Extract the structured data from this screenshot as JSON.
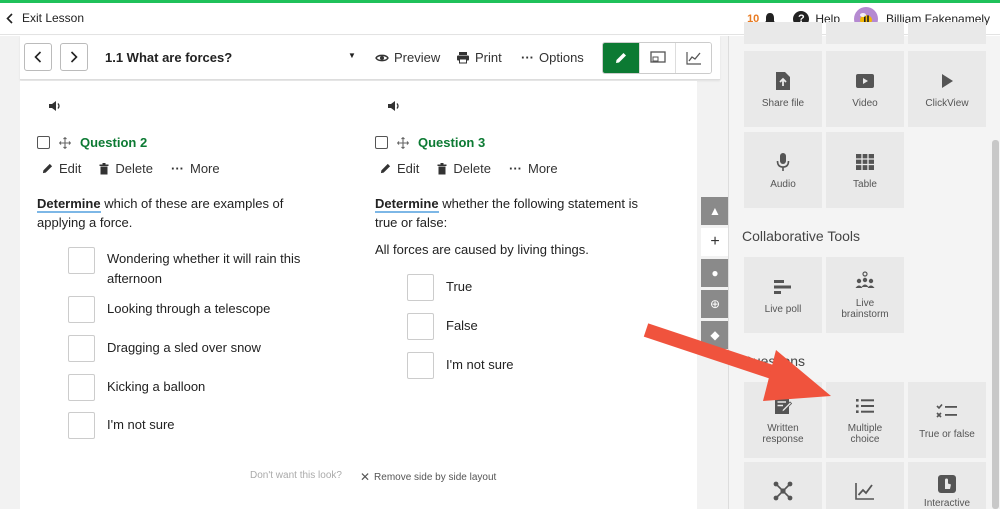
{
  "topbar": {
    "exit_label": "Exit Lesson",
    "notification_count": "10",
    "help_label": "Help",
    "user_name": "Billiam Fakenamely"
  },
  "toolbar": {
    "lesson_title": "1.1 What are forces?",
    "preview_label": "Preview",
    "print_label": "Print",
    "options_label": "Options"
  },
  "questions": [
    {
      "title": "Question 2",
      "edit_label": "Edit",
      "delete_label": "Delete",
      "more_label": "More",
      "keyword": "Determine",
      "prompt_rest_1": " which of these are examples of",
      "prompt_rest_2": "applying a force.",
      "options": [
        {
          "line1": "Wondering whether it will rain this",
          "line2": "afternoon"
        },
        {
          "line1": "Looking through a telescope",
          "line2": ""
        },
        {
          "line1": "Dragging a sled over snow",
          "line2": ""
        },
        {
          "line1": "Kicking a balloon",
          "line2": ""
        },
        {
          "line1": "I'm not sure",
          "line2": ""
        }
      ]
    },
    {
      "title": "Question 3",
      "edit_label": "Edit",
      "delete_label": "Delete",
      "more_label": "More",
      "keyword": "Determine",
      "prompt_rest_1": " whether the following statement is",
      "prompt_rest_2": "true or false:",
      "statement": "All forces are caused by living things.",
      "options": [
        {
          "line1": "True"
        },
        {
          "line1": "False"
        },
        {
          "line1": "I'm not sure"
        }
      ]
    }
  ],
  "footer": {
    "dont_want": "Don't want this look?",
    "remove_label": "Remove side by side layout"
  },
  "panel": {
    "media_tiles": [
      {
        "label": "Share file",
        "icon": "upload-file-icon"
      },
      {
        "label": "Video",
        "icon": "video-icon"
      },
      {
        "label": "ClickView",
        "icon": "play-icon"
      },
      {
        "label": "Audio",
        "icon": "microphone-icon"
      },
      {
        "label": "Table",
        "icon": "table-icon"
      }
    ],
    "collab_title": "Collaborative Tools",
    "collab_tiles": [
      {
        "label": "Live poll",
        "icon": "bar-chart-icon"
      },
      {
        "label1": "Live",
        "label2": "brainstorm",
        "icon": "people-icon"
      }
    ],
    "questions_title": "Questions",
    "question_tiles": [
      {
        "label1": "Written",
        "label2": "response",
        "icon": "edit-note-icon"
      },
      {
        "label1": "Multiple",
        "label2": "choice",
        "icon": "list-icon"
      },
      {
        "label": "True or false",
        "icon": "checklist-icon"
      },
      {
        "label": "",
        "icon": "network-icon"
      },
      {
        "label": "",
        "icon": "line-chart-icon"
      },
      {
        "label": "Interactive",
        "icon": "touch-icon"
      }
    ]
  },
  "colors": {
    "accent_green": "#0c7a33",
    "top_strip": "#1fc15a",
    "arrow": "#f0533d"
  }
}
